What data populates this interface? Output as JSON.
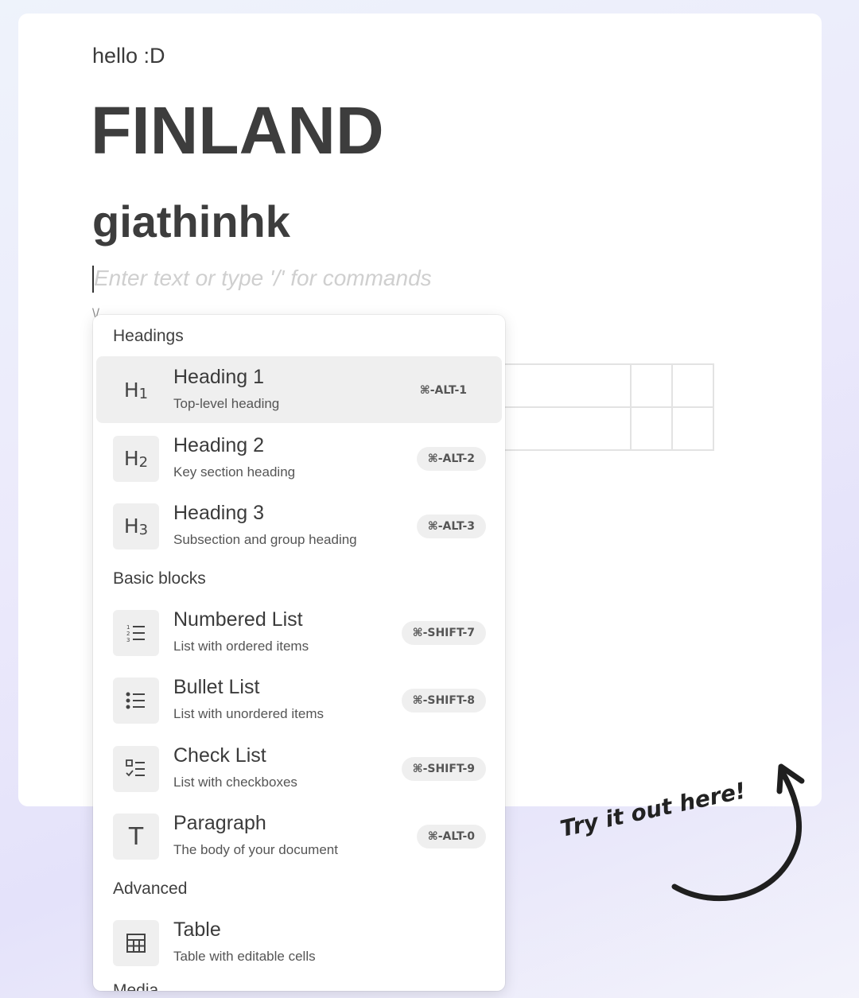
{
  "document": {
    "greeting": "hello :D",
    "heading1": "FINLAND",
    "heading2": "giathinhk",
    "placeholder": "Enter text or type '/' for commands",
    "slash_hint": "\\/"
  },
  "menu": {
    "sections": {
      "headings": "Headings",
      "basic": "Basic blocks",
      "advanced": "Advanced",
      "cut_off": "Media"
    },
    "items": [
      {
        "icon": "heading-1-icon",
        "icon_text": "H",
        "icon_sub": "1",
        "title": "Heading 1",
        "subtitle": "Top-level heading",
        "shortcut": "⌘-ALT-1",
        "active": true
      },
      {
        "icon": "heading-2-icon",
        "icon_text": "H",
        "icon_sub": "2",
        "title": "Heading 2",
        "subtitle": "Key section heading",
        "shortcut": "⌘-ALT-2"
      },
      {
        "icon": "heading-3-icon",
        "icon_text": "H",
        "icon_sub": "3",
        "title": "Heading 3",
        "subtitle": "Subsection and group heading",
        "shortcut": "⌘-ALT-3"
      },
      {
        "icon": "numbered-list-icon",
        "title": "Numbered List",
        "subtitle": "List with ordered items",
        "shortcut": "⌘-SHIFT-7"
      },
      {
        "icon": "bullet-list-icon",
        "title": "Bullet List",
        "subtitle": "List with unordered items",
        "shortcut": "⌘-SHIFT-8"
      },
      {
        "icon": "check-list-icon",
        "title": "Check List",
        "subtitle": "List with checkboxes",
        "shortcut": "⌘-SHIFT-9"
      },
      {
        "icon": "paragraph-icon",
        "icon_text": "T",
        "title": "Paragraph",
        "subtitle": "The body of your document",
        "shortcut": "⌘-ALT-0"
      },
      {
        "icon": "table-icon",
        "title": "Table",
        "subtitle": "Table with editable cells"
      }
    ]
  },
  "callout": {
    "text": "Try it out here!"
  }
}
